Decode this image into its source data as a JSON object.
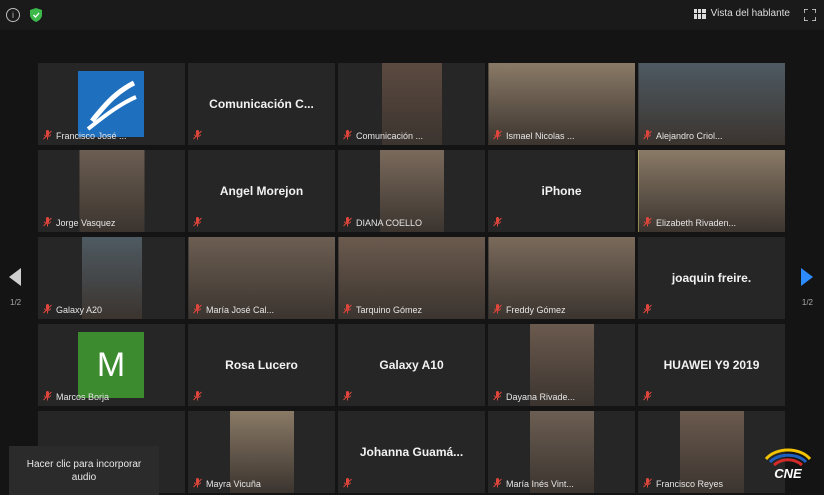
{
  "toolbar": {
    "speaker_view_label": "Vista del hablante"
  },
  "navigation": {
    "page_left": "1/2",
    "page_right": "1/2"
  },
  "audio_prompt": {
    "line1": "Hacer clic para incorporar",
    "line2": "audio"
  },
  "logo": {
    "text": "CNE"
  },
  "colors": {
    "active_speaker": "#e0d66a",
    "muted_mic": "#e0463b",
    "next_arrow": "#2d8cff"
  },
  "tiles": [
    {
      "name": "Francisco José ...",
      "label": "",
      "type": "logo"
    },
    {
      "name": "",
      "label": "Comunicación  C...",
      "type": "text"
    },
    {
      "name": "Comunicación ...",
      "label": "",
      "type": "video"
    },
    {
      "name": "Ismael Nicolas ...",
      "label": "",
      "type": "video"
    },
    {
      "name": "Alejandro Criol...",
      "label": "",
      "type": "video"
    },
    {
      "name": "Jorge Vasquez",
      "label": "",
      "type": "video"
    },
    {
      "name": "",
      "label": "Angel Morejon",
      "type": "text"
    },
    {
      "name": "DIANA COELLO",
      "label": "",
      "type": "video"
    },
    {
      "name": "",
      "label": "iPhone",
      "type": "text"
    },
    {
      "name": "Elizabeth Rivaden...",
      "label": "",
      "type": "video",
      "active": true
    },
    {
      "name": "Galaxy A20",
      "label": "",
      "type": "video"
    },
    {
      "name": "María José Cal...",
      "label": "",
      "type": "video"
    },
    {
      "name": "Tarquino Gómez",
      "label": "",
      "type": "video"
    },
    {
      "name": "Freddy Gómez",
      "label": "",
      "type": "video"
    },
    {
      "name": "",
      "label": "joaquin  freire.",
      "type": "text"
    },
    {
      "name": "Marcos Borja",
      "label": "M",
      "type": "avatar"
    },
    {
      "name": "",
      "label": "Rosa Lucero",
      "type": "text"
    },
    {
      "name": "",
      "label": "Galaxy A10",
      "type": "text"
    },
    {
      "name": "Dayana Rivade...",
      "label": "",
      "type": "video"
    },
    {
      "name": "",
      "label": "HUAWEI Y9 2019",
      "type": "text"
    },
    {
      "name": "",
      "label": "",
      "type": "empty"
    },
    {
      "name": "Mayra Vicuña",
      "label": "",
      "type": "video"
    },
    {
      "name": "",
      "label": "Johanna  Guamá...",
      "type": "text"
    },
    {
      "name": "María Inés Vint...",
      "label": "",
      "type": "video"
    },
    {
      "name": "Francisco Reyes",
      "label": "",
      "type": "video"
    }
  ]
}
